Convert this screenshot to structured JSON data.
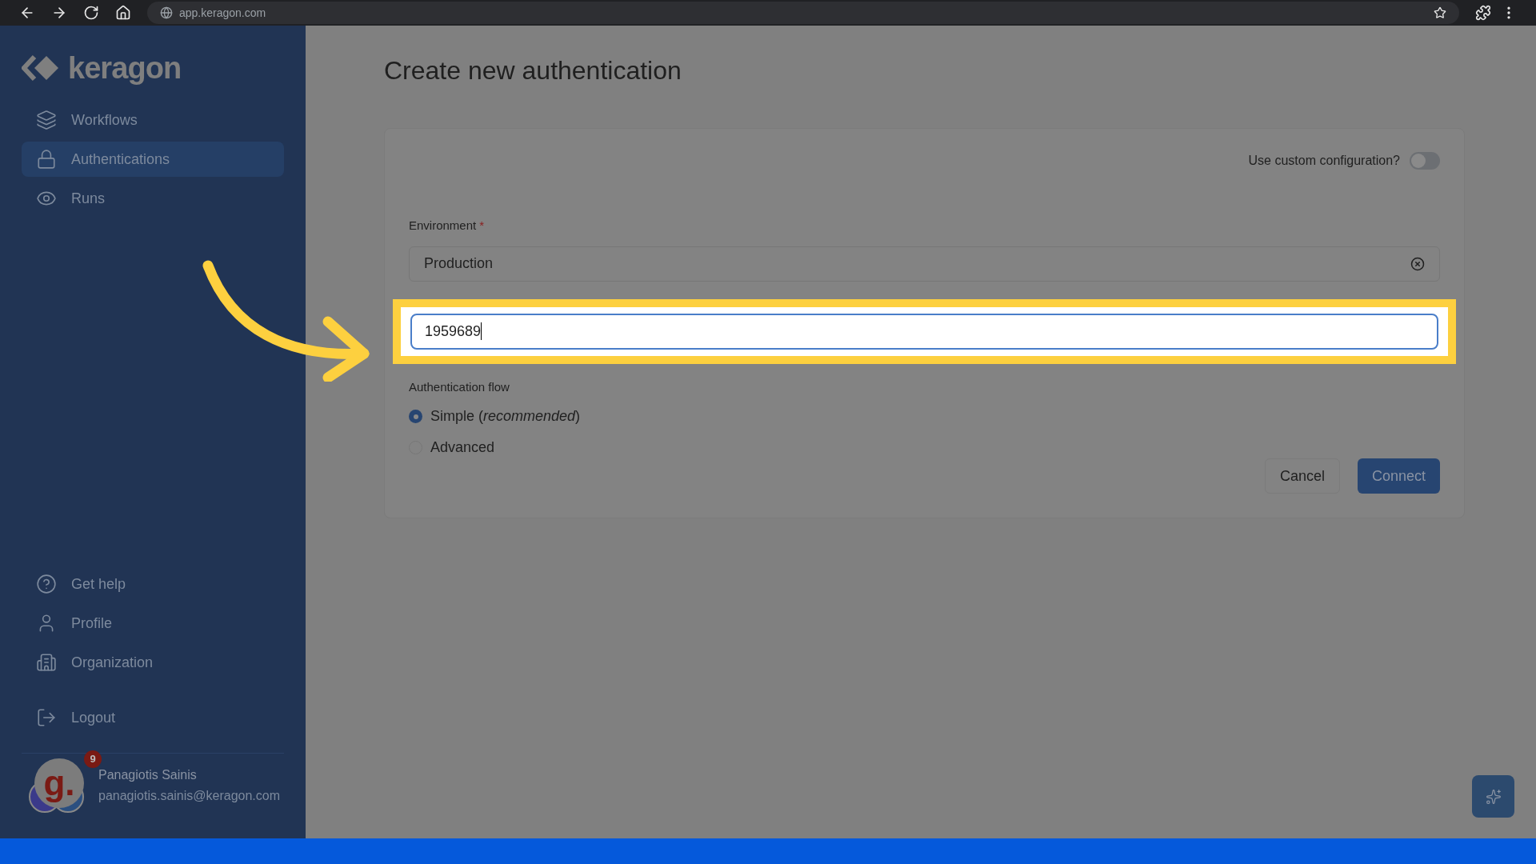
{
  "browser": {
    "url": "app.keragon.com"
  },
  "sidebar": {
    "logo": "keragon",
    "nav": [
      {
        "label": "Workflows",
        "selected": false
      },
      {
        "label": "Authentications",
        "selected": true
      },
      {
        "label": "Runs",
        "selected": false
      }
    ],
    "footer_nav": [
      {
        "label": "Get help"
      },
      {
        "label": "Profile"
      },
      {
        "label": "Organization"
      }
    ],
    "logout": "Logout",
    "user": {
      "avatar_letter": "g.",
      "badge": "9",
      "name": "Panagiotis Sainis",
      "email": "panagiotis.sainis@keragon.com"
    }
  },
  "main": {
    "title": "Create new authentication",
    "custom_config": {
      "label": "Use custom configuration?",
      "on": false
    },
    "environment": {
      "label": "Environment",
      "required_mark": "*",
      "value": "Production"
    },
    "practice_id": {
      "value": "1959689",
      "highlighted": true
    },
    "auth_flow": {
      "label": "Authentication flow",
      "options": [
        {
          "label": "Simple (*recommended*)",
          "selected": true
        },
        {
          "label": "Advanced",
          "selected": false
        }
      ]
    },
    "buttons": {
      "cancel": "Cancel",
      "connect": "Connect"
    }
  }
}
